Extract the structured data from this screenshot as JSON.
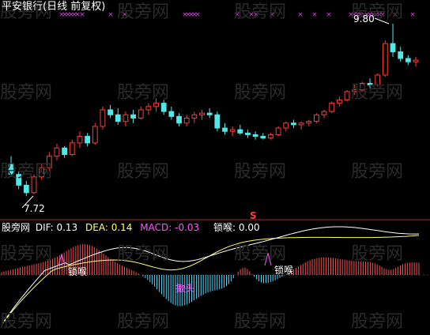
{
  "title": "平安银行(日线 前复权)",
  "price_panel": {
    "high_label": "9.80",
    "low_label": "7.72",
    "candles": [
      [
        8.1,
        8.2,
        7.95,
        7.98
      ],
      [
        7.98,
        8.02,
        7.8,
        7.85
      ],
      [
        7.85,
        7.9,
        7.72,
        7.76
      ],
      [
        7.76,
        7.98,
        7.74,
        7.95
      ],
      [
        7.95,
        8.1,
        7.92,
        8.06
      ],
      [
        8.06,
        8.25,
        8.02,
        8.2
      ],
      [
        8.2,
        8.35,
        8.15,
        8.3
      ],
      [
        8.3,
        8.32,
        8.18,
        8.22
      ],
      [
        8.22,
        8.4,
        8.2,
        8.36
      ],
      [
        8.36,
        8.5,
        8.3,
        8.44
      ],
      [
        8.44,
        8.48,
        8.32,
        8.36
      ],
      [
        8.36,
        8.6,
        8.34,
        8.56
      ],
      [
        8.56,
        8.8,
        8.52,
        8.76
      ],
      [
        8.76,
        8.82,
        8.66,
        8.7
      ],
      [
        8.7,
        8.78,
        8.58,
        8.62
      ],
      [
        8.62,
        8.74,
        8.56,
        8.7
      ],
      [
        8.7,
        8.76,
        8.6,
        8.66
      ],
      [
        8.66,
        8.8,
        8.64,
        8.76
      ],
      [
        8.76,
        8.84,
        8.7,
        8.8
      ],
      [
        8.8,
        8.9,
        8.74,
        8.84
      ],
      [
        8.84,
        8.88,
        8.7,
        8.74
      ],
      [
        8.74,
        8.8,
        8.64,
        8.68
      ],
      [
        8.68,
        8.72,
        8.56,
        8.6
      ],
      [
        8.6,
        8.7,
        8.56,
        8.66
      ],
      [
        8.66,
        8.74,
        8.6,
        8.7
      ],
      [
        8.7,
        8.76,
        8.64,
        8.72
      ],
      [
        8.72,
        8.78,
        8.66,
        8.7
      ],
      [
        8.7,
        8.74,
        8.5,
        8.54
      ],
      [
        8.54,
        8.6,
        8.46,
        8.5
      ],
      [
        8.5,
        8.56,
        8.44,
        8.52
      ],
      [
        8.52,
        8.58,
        8.46,
        8.48
      ],
      [
        8.48,
        8.52,
        8.42,
        8.46
      ],
      [
        8.46,
        8.5,
        8.4,
        8.44
      ],
      [
        8.44,
        8.48,
        8.4,
        8.42
      ],
      [
        8.42,
        8.48,
        8.4,
        8.46
      ],
      [
        8.46,
        8.56,
        8.44,
        8.54
      ],
      [
        8.54,
        8.62,
        8.5,
        8.6
      ],
      [
        8.6,
        8.64,
        8.54,
        8.58
      ],
      [
        8.58,
        8.62,
        8.52,
        8.6
      ],
      [
        8.6,
        8.64,
        8.56,
        8.62
      ],
      [
        8.62,
        8.72,
        8.6,
        8.7
      ],
      [
        8.7,
        8.76,
        8.66,
        8.74
      ],
      [
        8.74,
        8.86,
        8.72,
        8.84
      ],
      [
        8.84,
        8.92,
        8.8,
        8.88
      ],
      [
        8.88,
        9.0,
        8.86,
        8.98
      ],
      [
        8.98,
        9.06,
        8.94,
        9.0
      ],
      [
        9.0,
        9.1,
        8.98,
        9.08
      ],
      [
        9.08,
        9.14,
        9.02,
        9.06
      ],
      [
        9.06,
        9.2,
        9.04,
        9.18
      ],
      [
        9.18,
        9.6,
        9.16,
        9.56
      ],
      [
        9.56,
        9.8,
        9.4,
        9.46
      ],
      [
        9.46,
        9.52,
        9.34,
        9.38
      ],
      [
        9.38,
        9.42,
        9.3,
        9.34
      ],
      [
        9.34,
        9.4,
        9.28,
        9.36
      ]
    ]
  },
  "indicator_panel": {
    "brand": "股旁网",
    "dif_label": "DIF:",
    "dif_value": "0.13",
    "dea_label": "DEA:",
    "dea_value": "0.14",
    "macd_label": "MACD:",
    "macd_value": "-0.03",
    "lock_label": "锁喉:",
    "lock_value": "0.00",
    "annotations": {
      "lock1": "锁喉",
      "lock2": "锁喉",
      "exit": "撤头"
    },
    "signal_mark": "S"
  },
  "watermark": "股旁网",
  "colors": {
    "up": "#ff3b3b",
    "down": "#50e8e8",
    "dif": "#ffffff",
    "dea": "#ffff66",
    "macd": "#ff55ff",
    "lock": "#ffffff"
  }
}
